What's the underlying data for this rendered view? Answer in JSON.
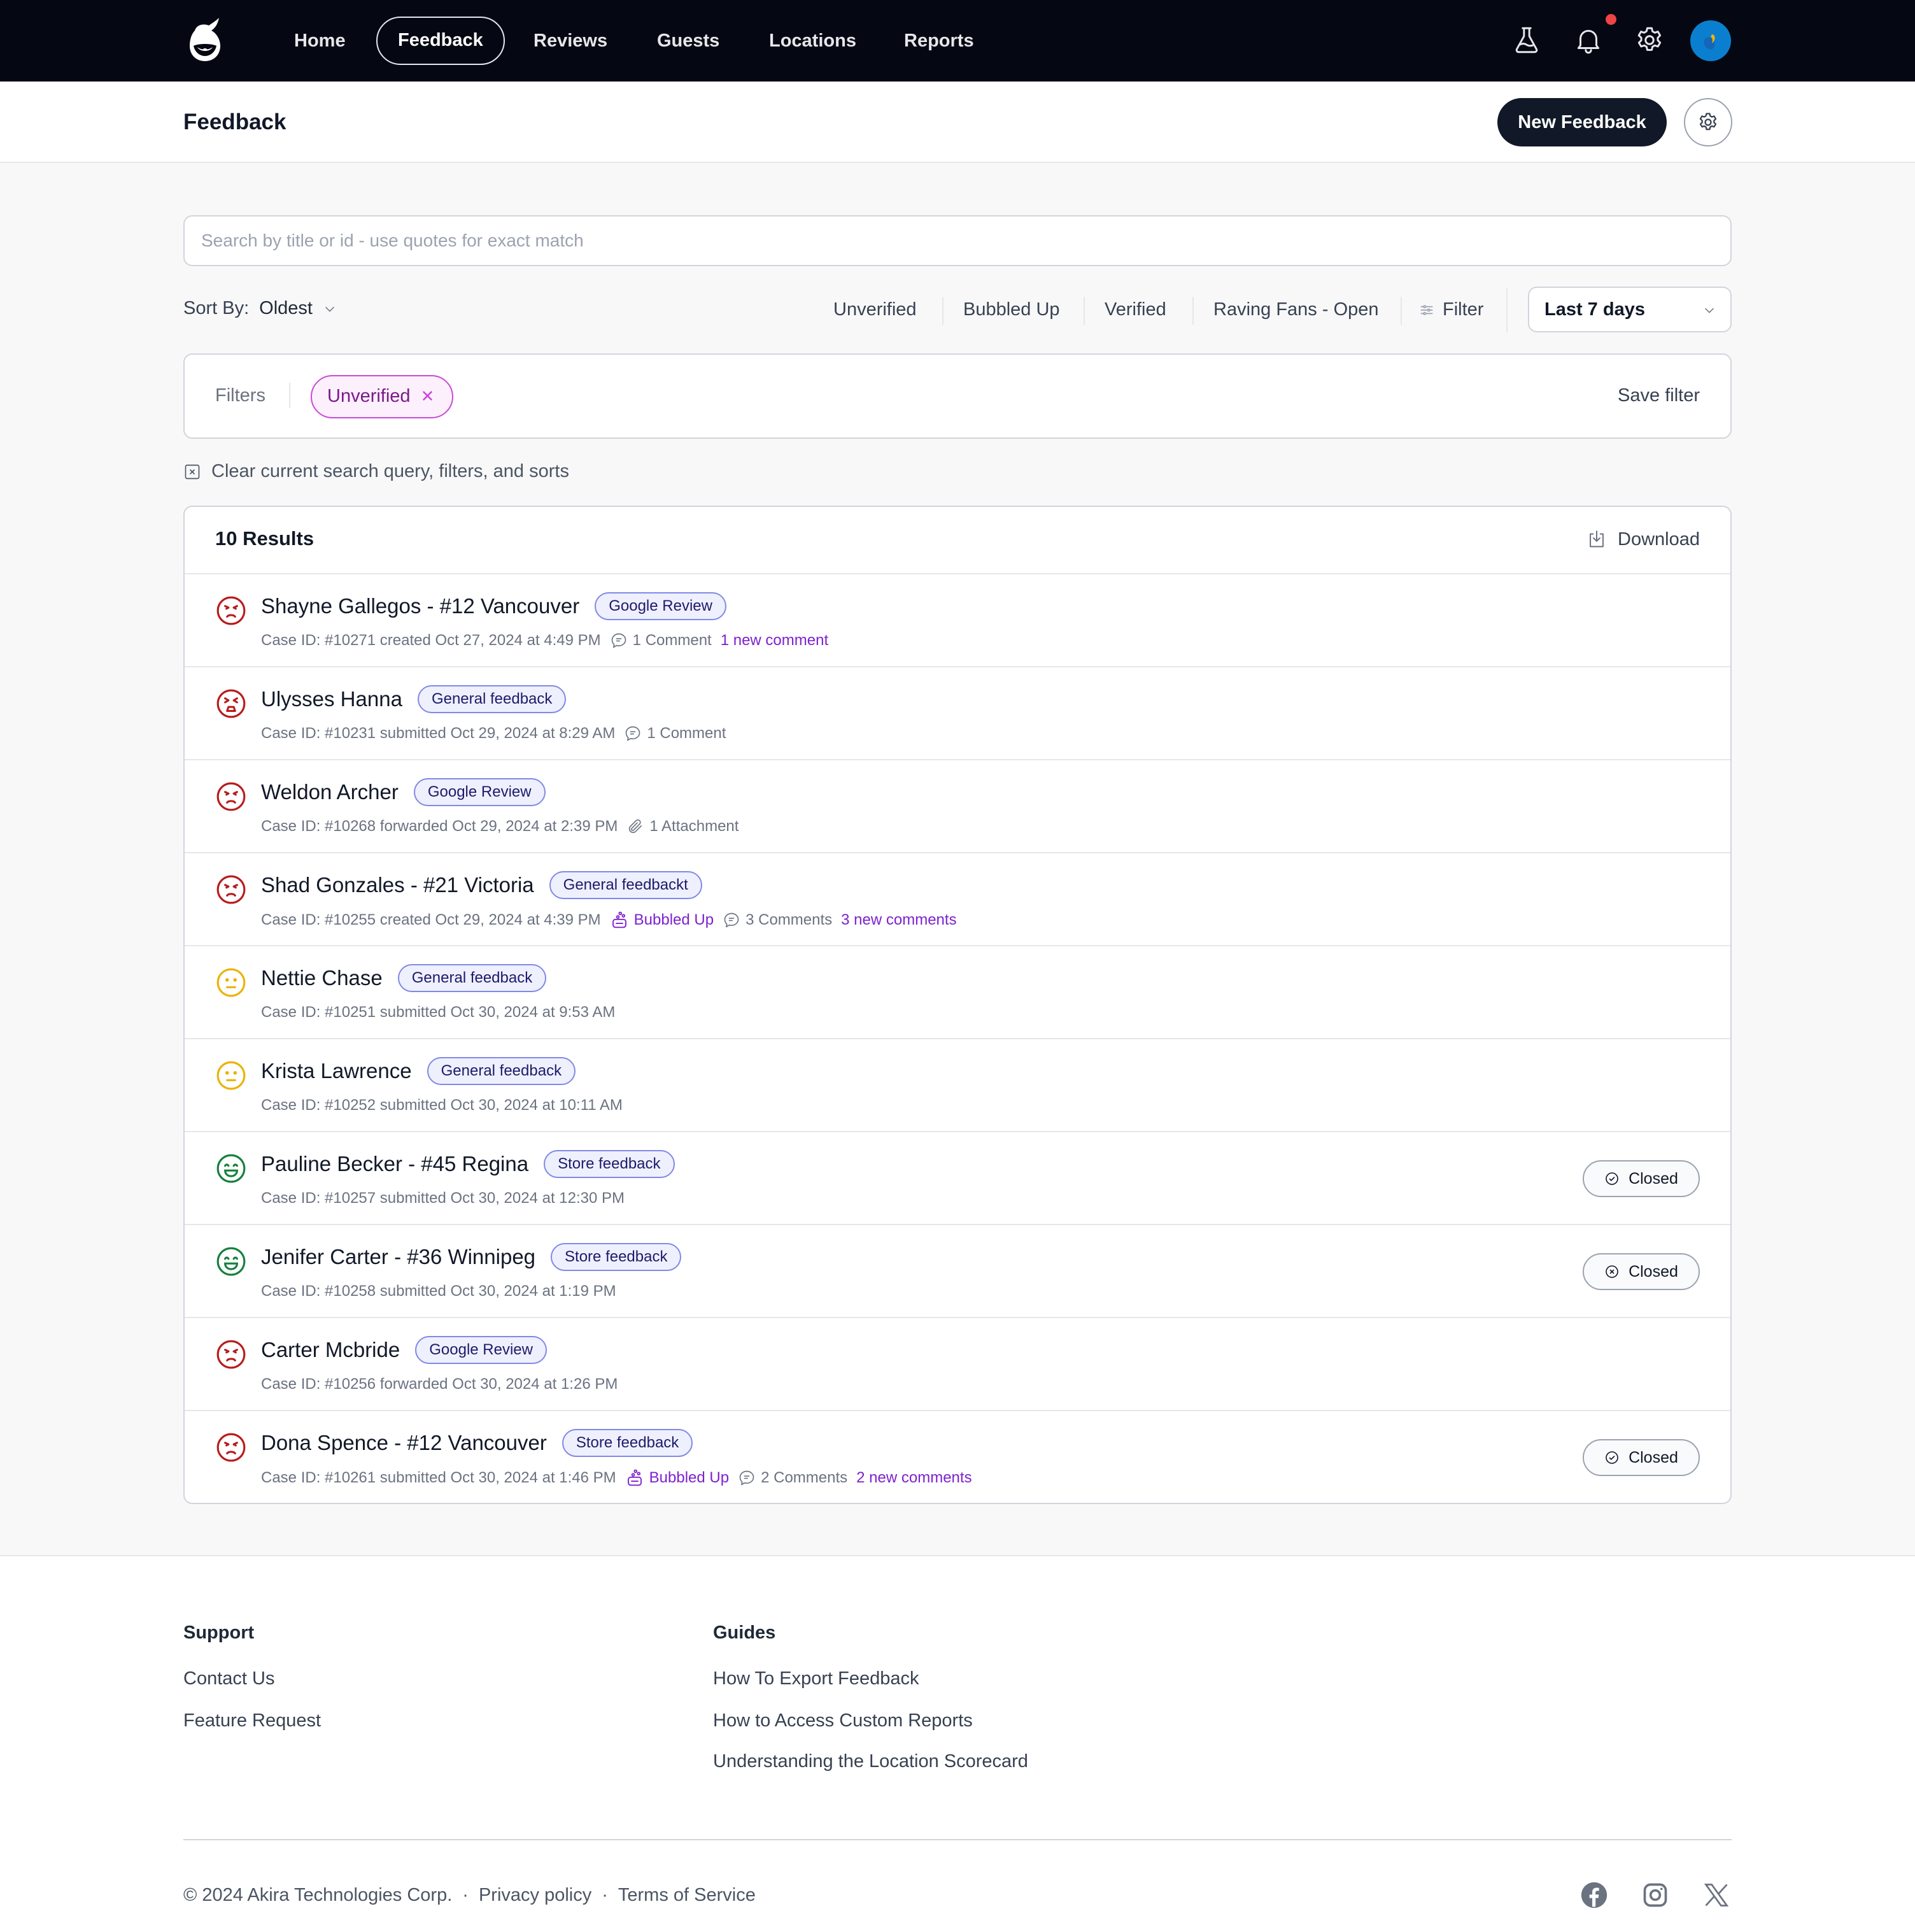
{
  "nav": {
    "items": [
      {
        "label": "Home",
        "active": false
      },
      {
        "label": "Feedback",
        "active": true
      },
      {
        "label": "Reviews",
        "active": false
      },
      {
        "label": "Guests",
        "active": false
      },
      {
        "label": "Locations",
        "active": false
      },
      {
        "label": "Reports",
        "active": false
      }
    ],
    "icons": [
      "flask-icon",
      "bell-icon",
      "gear-icon",
      "avatar"
    ],
    "has_notification": true
  },
  "header": {
    "title": "Feedback",
    "new_button": "New Feedback"
  },
  "search": {
    "placeholder": "Search by title or id - use quotes for exact match",
    "value": ""
  },
  "sort": {
    "label": "Sort By:",
    "value": "Oldest"
  },
  "quick_filters": [
    "Unverified",
    "Bubbled Up",
    "Verified",
    "Raving Fans - Open"
  ],
  "filter_button": "Filter",
  "date_range": "Last 7 days",
  "filters": {
    "label": "Filters",
    "active": [
      {
        "label": "Unverified"
      }
    ],
    "save_label": "Save filter"
  },
  "clear_label": "Clear current search query, filters, and sorts",
  "results": {
    "count_label": "10 Results",
    "download_label": "Download",
    "rows": [
      {
        "sentiment": "angry",
        "name": "Shayne Gallegos - #12 Vancouver",
        "tag": "Google Review",
        "meta": "Case ID: #10271 created Oct 27, 2024 at 4:49 PM",
        "bubbled": "",
        "attachment": "",
        "comments": "1 Comment",
        "new_comments": "1 new comment",
        "status": ""
      },
      {
        "sentiment": "very-angry",
        "name": "Ulysses Hanna",
        "tag": "General feedback",
        "meta": "Case ID: #10231 submitted Oct 29, 2024 at 8:29 AM",
        "bubbled": "",
        "attachment": "",
        "comments": "1 Comment",
        "new_comments": "",
        "status": ""
      },
      {
        "sentiment": "angry",
        "name": "Weldon Archer",
        "tag": "Google Review",
        "meta": "Case ID: #10268 forwarded Oct 29, 2024 at 2:39 PM",
        "bubbled": "",
        "attachment": "1 Attachment",
        "comments": "",
        "new_comments": "",
        "status": ""
      },
      {
        "sentiment": "angry",
        "name": "Shad Gonzales - #21 Victoria",
        "tag": "General feedbackt",
        "meta": "Case ID: #10255 created Oct 29, 2024 at 4:39 PM",
        "bubbled": "Bubbled Up",
        "attachment": "",
        "comments": "3 Comments",
        "new_comments": "3 new comments",
        "status": ""
      },
      {
        "sentiment": "neutral",
        "name": "Nettie Chase",
        "tag": "General feedback",
        "meta": "Case ID: #10251 submitted Oct 30, 2024 at 9:53 AM",
        "bubbled": "",
        "attachment": "",
        "comments": "",
        "new_comments": "",
        "status": ""
      },
      {
        "sentiment": "neutral",
        "name": "Krista Lawrence",
        "tag": "General feedback",
        "meta": "Case ID: #10252 submitted Oct 30, 2024 at 10:11 AM",
        "bubbled": "",
        "attachment": "",
        "comments": "",
        "new_comments": "",
        "status": ""
      },
      {
        "sentiment": "happy",
        "name": "Pauline Becker - #45 Regina",
        "tag": "Store feedback",
        "meta": "Case ID: #10257 submitted Oct 30, 2024 at 12:30 PM",
        "bubbled": "",
        "attachment": "",
        "comments": "",
        "new_comments": "",
        "status": "Closed",
        "status_icon": "check-circle-icon"
      },
      {
        "sentiment": "happy",
        "name": "Jenifer Carter - #36 Winnipeg",
        "tag": "Store feedback",
        "meta": "Case ID: #10258 submitted Oct 30, 2024 at 1:19 PM",
        "bubbled": "",
        "attachment": "",
        "comments": "",
        "new_comments": "",
        "status": "Closed",
        "status_icon": "x-circle-icon"
      },
      {
        "sentiment": "angry",
        "name": "Carter Mcbride",
        "tag": "Google Review",
        "meta": "Case ID: #10256 forwarded Oct 30, 2024 at 1:26 PM",
        "bubbled": "",
        "attachment": "",
        "comments": "",
        "new_comments": "",
        "status": ""
      },
      {
        "sentiment": "angry",
        "name": "Dona Spence - #12 Vancouver",
        "tag": "Store feedback",
        "meta": "Case ID: #10261 submitted Oct 30, 2024 at 1:46 PM",
        "bubbled": "Bubbled Up",
        "attachment": "",
        "comments": "2 Comments",
        "new_comments": "2 new comments",
        "status": "Closed",
        "status_icon": "check-circle-icon"
      }
    ]
  },
  "footer": {
    "support": {
      "title": "Support",
      "links": [
        "Contact Us",
        "Feature Request"
      ]
    },
    "guides": {
      "title": "Guides",
      "links": [
        "How To Export Feedback",
        "How to Access Custom Reports",
        "Understanding the Location Scorecard"
      ]
    },
    "copyright": "© 2024 Akira Technologies Corp.",
    "privacy": "Privacy policy",
    "terms": "Terms of Service",
    "separator": "·",
    "social": [
      "facebook-icon",
      "instagram-icon",
      "x-icon"
    ]
  },
  "colors": {
    "nav_bg": "#050813",
    "primary_dark": "#111827",
    "angry": "#b91c1c",
    "neutral": "#eab308",
    "happy": "#15803d",
    "purple": "#7e22ce",
    "chip_border": "#c94ad6",
    "tag_border": "#8189e6"
  }
}
